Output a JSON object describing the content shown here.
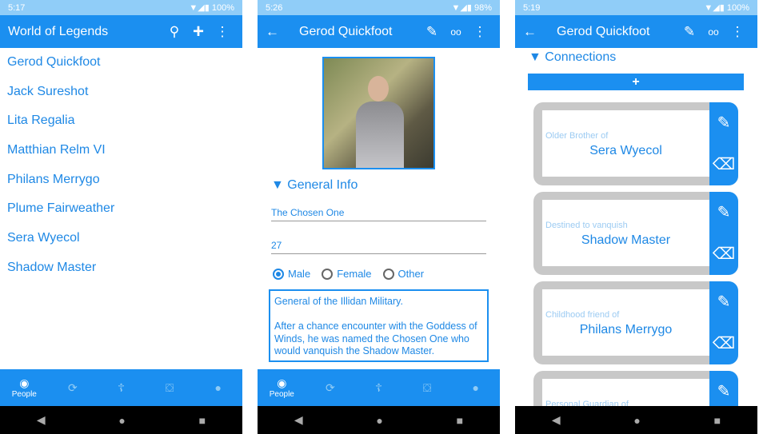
{
  "screens": [
    {
      "status": {
        "time": "5:17",
        "battery": "100%"
      },
      "title": "World of Legends",
      "actions": [
        "search-icon",
        "plus-icon",
        "more-vert-icon"
      ],
      "people": [
        "Gerod Quickfoot",
        "Jack Sureshot",
        "Lita Regalia",
        "Matthian Relm VI",
        "Philans Merrygo",
        "Plume Fairweather",
        "Sera Wyecol",
        "Shadow Master"
      ]
    },
    {
      "status": {
        "time": "5:26",
        "battery": "98%"
      },
      "title": "Gerod Quickfoot",
      "section": "▼ General Info",
      "epithet": "The Chosen One",
      "age": "27",
      "gender": {
        "options": [
          "Male",
          "Female",
          "Other"
        ],
        "selected": "Male"
      },
      "description": "General of the Illidan Military.\n\nAfter a chance encounter with the Goddess of Winds, he was named the Chosen One who would vanquish the Shadow Master."
    },
    {
      "status": {
        "time": "5:19",
        "battery": "100%"
      },
      "title": "Gerod Quickfoot",
      "section": "▼ Connections",
      "add_label": "+",
      "connections": [
        {
          "relation": "Older Brother of",
          "name": "Sera Wyecol"
        },
        {
          "relation": "Destined to vanquish",
          "name": "Shadow Master"
        },
        {
          "relation": "Childhood friend of",
          "name": "Philans Merrygo"
        },
        {
          "relation": "Personal Guardian of",
          "name": ""
        }
      ]
    }
  ],
  "bottom_nav": {
    "active_label": "People",
    "icons": [
      "people-icon",
      "relations-icon",
      "religion-icon",
      "inventory-icon",
      "places-icon"
    ]
  },
  "colors": {
    "primary": "#1b8ff0",
    "status_bar": "#90cdf8",
    "text": "#1e88e5"
  }
}
